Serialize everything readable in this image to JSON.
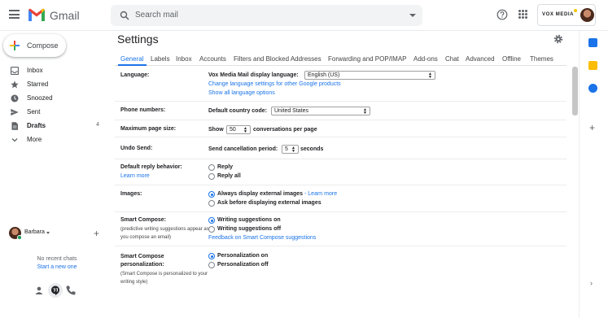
{
  "header": {
    "app_name": "Gmail",
    "search_placeholder": "Search mail",
    "account_brand": "VOX MEDIA"
  },
  "sidebar": {
    "compose_label": "Compose",
    "items": [
      {
        "label": "Inbox",
        "icon": "inbox-icon",
        "count": ""
      },
      {
        "label": "Starred",
        "icon": "star-icon",
        "count": ""
      },
      {
        "label": "Snoozed",
        "icon": "clock-icon",
        "count": ""
      },
      {
        "label": "Sent",
        "icon": "send-icon",
        "count": ""
      },
      {
        "label": "Drafts",
        "icon": "draft-icon",
        "count": "4"
      },
      {
        "label": "More",
        "icon": "chevron-down-icon",
        "count": ""
      }
    ],
    "hangouts": {
      "user": "Barbara",
      "no_chats": "No recent chats",
      "start_new": "Start a new one"
    }
  },
  "settings": {
    "title": "Settings",
    "tabs": [
      "General",
      "Labels",
      "Inbox",
      "Accounts",
      "Filters and Blocked Addresses",
      "Forwarding and POP/IMAP",
      "Add-ons",
      "Chat",
      "Advanced",
      "Offline",
      "Themes"
    ],
    "active_tab": "General",
    "language": {
      "label": "Language:",
      "display_label": "Vox Media Mail display language:",
      "value": "English (US)",
      "link1": "Change language settings for other Google products",
      "link2": "Show all language options"
    },
    "phone": {
      "label": "Phone numbers:",
      "field_label": "Default country code:",
      "value": "United States"
    },
    "page_size": {
      "label": "Maximum page size:",
      "prefix": "Show",
      "value": "50",
      "suffix": "conversations per page"
    },
    "undo": {
      "label": "Undo Send:",
      "prefix": "Send cancellation period:",
      "value": "5",
      "suffix": "seconds"
    },
    "reply": {
      "label": "Default reply behavior:",
      "learn_more": "Learn more",
      "options": [
        "Reply",
        "Reply all"
      ],
      "selected": "none"
    },
    "images": {
      "label": "Images:",
      "options": [
        "Always display external images",
        "Ask before displaying external images"
      ],
      "option1_link": "- Learn more",
      "selected": 0
    },
    "smart_compose": {
      "label": "Smart Compose:",
      "sub": "(predictive writing suggestions appear as you compose an email)",
      "options": [
        "Writing suggestions on",
        "Writing suggestions off"
      ],
      "selected": 0,
      "feedback_link": "Feedback on Smart Compose suggestions"
    },
    "personalization": {
      "label": "Smart Compose personalization:",
      "sub": "(Smart Compose is personalized to your writing style)",
      "options": [
        "Personalization on",
        "Personalization off"
      ],
      "selected": 0
    }
  },
  "colors": {
    "accent": "#1a73e8",
    "gmail_red": "#ea4335"
  }
}
